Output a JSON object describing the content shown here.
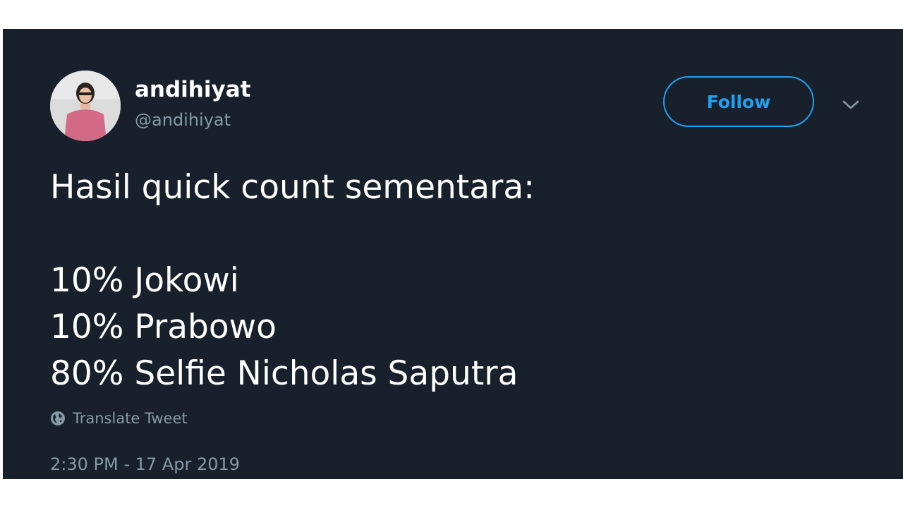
{
  "user": {
    "display_name": "andihiyat",
    "handle": "@andihiyat"
  },
  "header": {
    "follow_label": "Follow",
    "menu_icon": "chevron-down-icon"
  },
  "tweet": {
    "lines": [
      "Hasil quick count sementara:",
      "",
      "10% Jokowi",
      "10% Prabowo",
      "80% Selfie Nicholas Saputra"
    ],
    "translate_label": "Translate Tweet",
    "translate_icon": "globe-icon",
    "timestamp": "2:30 PM - 17 Apr 2019"
  },
  "colors": {
    "background": "#17202b",
    "accent": "#1da1f2",
    "text_primary": "#ffffff",
    "text_secondary": "#8899a6"
  }
}
